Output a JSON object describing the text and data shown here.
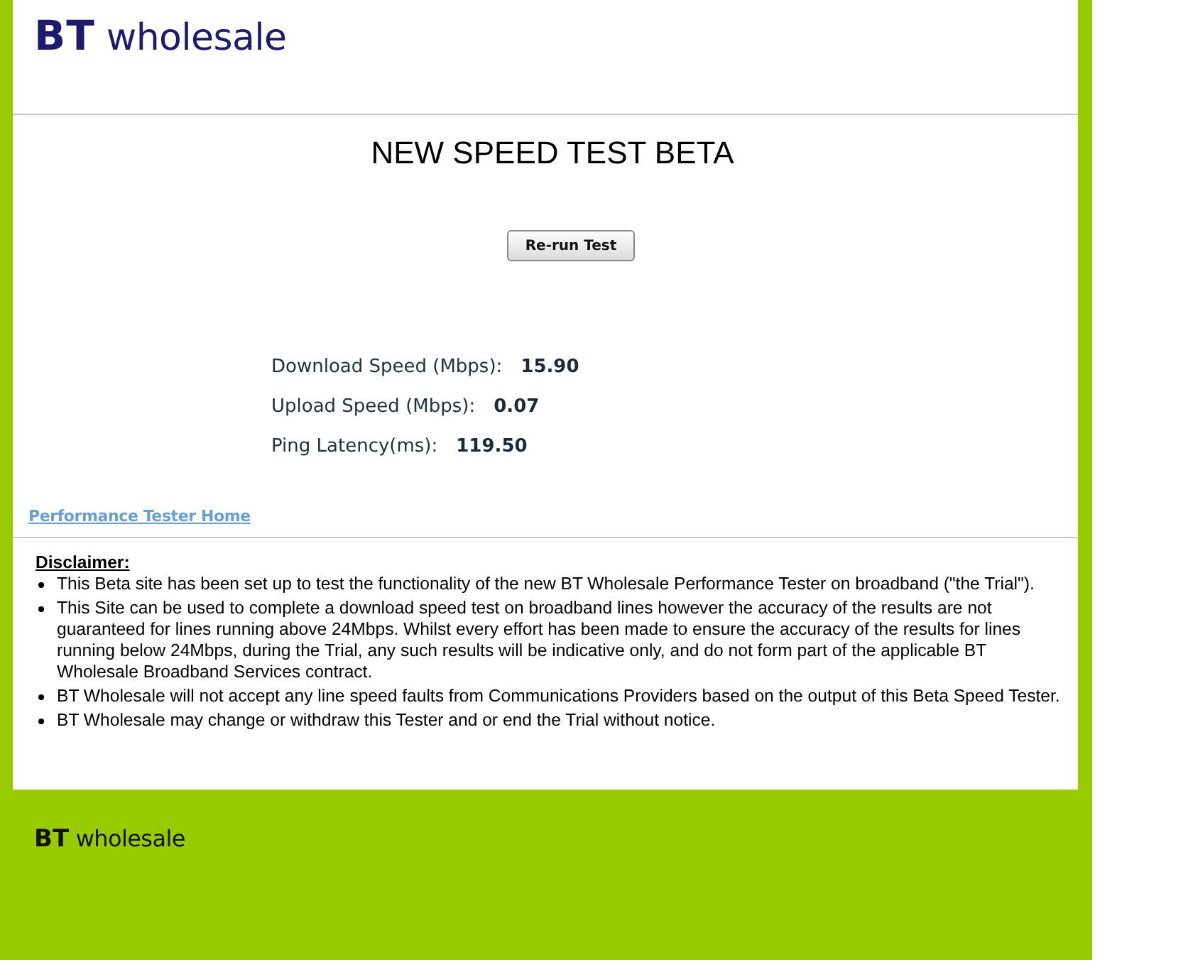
{
  "header": {
    "logo": {
      "mark": "BT",
      "word": "wholesale"
    }
  },
  "main": {
    "title": "NEW SPEED TEST BETA",
    "rerun_button": "Re-run Test",
    "results": [
      {
        "label": "Download Speed (Mbps):",
        "value": "15.90"
      },
      {
        "label": "Upload Speed (Mbps):",
        "value": "0.07"
      },
      {
        "label": "Ping Latency(ms):",
        "value": "119.50"
      }
    ],
    "home_link": "Performance Tester Home"
  },
  "disclaimer": {
    "heading": "Disclaimer:",
    "items": [
      "This Beta site has been set up to test the functionality of the new BT Wholesale Performance Tester on broadband (\"the Trial\").",
      "This Site can be used to complete a download speed test on broadband lines however the accuracy of the results are not guaranteed for lines running above 24Mbps. Whilst every effort has been made to ensure the accuracy of the results for lines running below 24Mbps, during the Trial, any such results will be indicative only, and do not form part of the applicable BT Wholesale Broadband Services contract.",
      "BT Wholesale will not accept any line speed faults from Communications Providers based on the output of this Beta Speed Tester.",
      "BT Wholesale may change or withdraw this Tester and or end the Trial without notice."
    ]
  },
  "footer": {
    "logo": {
      "mark": "BT",
      "word": "wholesale"
    }
  }
}
